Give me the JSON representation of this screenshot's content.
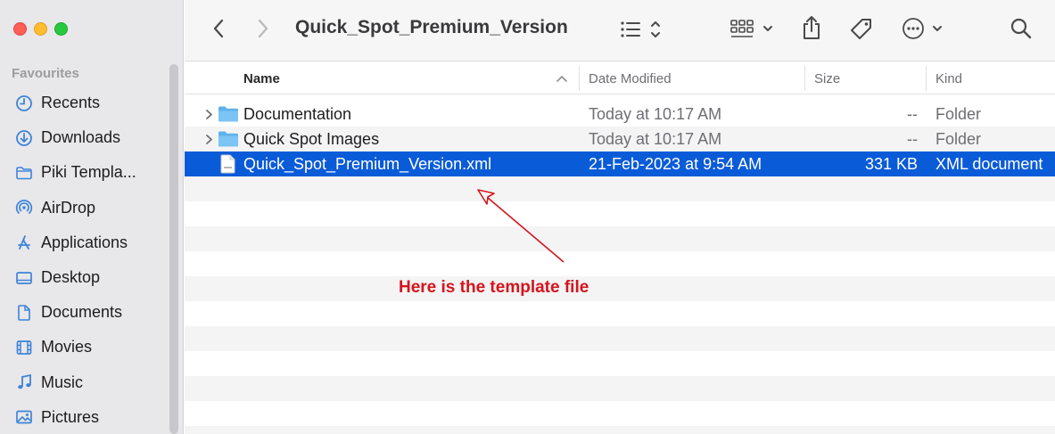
{
  "window": {
    "title": "Quick_Spot_Premium_Version"
  },
  "sidebar": {
    "heading": "Favourites",
    "items": [
      {
        "label": "Recents",
        "icon": "clock-icon"
      },
      {
        "label": "Downloads",
        "icon": "download-icon"
      },
      {
        "label": "Piki Templa...",
        "icon": "folder-icon"
      },
      {
        "label": "AirDrop",
        "icon": "airdrop-icon"
      },
      {
        "label": "Applications",
        "icon": "applications-icon"
      },
      {
        "label": "Desktop",
        "icon": "desktop-icon"
      },
      {
        "label": "Documents",
        "icon": "document-icon"
      },
      {
        "label": "Movies",
        "icon": "film-icon"
      },
      {
        "label": "Music",
        "icon": "music-note-icon"
      },
      {
        "label": "Pictures",
        "icon": "photo-icon"
      }
    ]
  },
  "columns": {
    "name": "Name",
    "date": "Date Modified",
    "size": "Size",
    "kind": "Kind"
  },
  "files": [
    {
      "name": "Documentation",
      "date": "Today at 10:17 AM",
      "size": "--",
      "kind": "Folder",
      "type": "folder",
      "selected": false
    },
    {
      "name": "Quick Spot Images",
      "date": "Today at 10:17 AM",
      "size": "--",
      "kind": "Folder",
      "type": "folder",
      "selected": false
    },
    {
      "name": "Quick_Spot_Premium_Version.xml",
      "date": "21-Feb-2023 at 9:54 AM",
      "size": "331 KB",
      "kind": "XML document",
      "type": "xml-file",
      "selected": true
    }
  ],
  "annotation": {
    "text": "Here is the template file",
    "color": "#d6141c"
  },
  "colors": {
    "accent": "#0a5bd8",
    "sidebar_icon": "#3d84d8",
    "folder": "#5fb2ec"
  }
}
